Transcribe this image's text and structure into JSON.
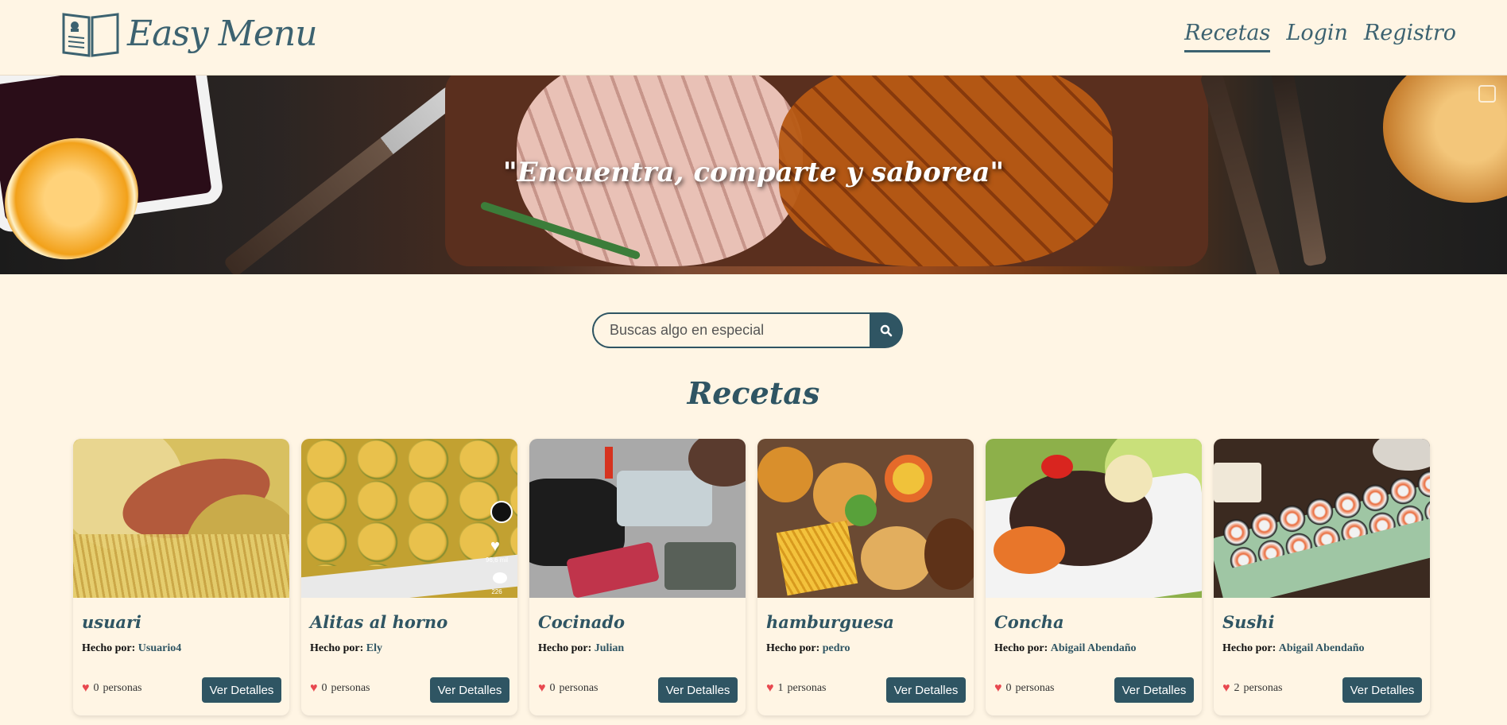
{
  "header": {
    "brand": "Easy Menu",
    "nav": [
      {
        "label": "Recetas",
        "active": true
      },
      {
        "label": "Login",
        "active": false
      },
      {
        "label": "Registro",
        "active": false
      }
    ]
  },
  "hero": {
    "quote": "\"Encuentra, comparte y saborea\""
  },
  "search": {
    "placeholder": "Buscas algo en especial",
    "value": ""
  },
  "section": {
    "title": "Recetas"
  },
  "recipes": [
    {
      "title": "usuari",
      "author_label": "Hecho por:",
      "author": "Usuario4",
      "likes": "0",
      "likes_unit": "personas",
      "button": "Ver Detalles"
    },
    {
      "title": "Alitas al horno",
      "author_label": "Hecho por:",
      "author": "Ely",
      "likes": "0",
      "likes_unit": "personas",
      "button": "Ver Detalles"
    },
    {
      "title": "Cocinado",
      "author_label": "Hecho por:",
      "author": "Julian",
      "likes": "0",
      "likes_unit": "personas",
      "button": "Ver Detalles"
    },
    {
      "title": "hamburguesa",
      "author_label": "Hecho por:",
      "author": "pedro",
      "likes": "1",
      "likes_unit": "personas",
      "button": "Ver Detalles"
    },
    {
      "title": "Concha",
      "author_label": "Hecho por:",
      "author": "Abigail Abendaño",
      "likes": "0",
      "likes_unit": "personas",
      "button": "Ver Detalles"
    },
    {
      "title": "Sushi",
      "author_label": "Hecho por:",
      "author": "Abigail Abendaño",
      "likes": "2",
      "likes_unit": "personas",
      "button": "Ver Detalles"
    }
  ],
  "recipe_overlay": {
    "likes_count": "96,6 mil",
    "comments_count": "226"
  },
  "colors": {
    "accent": "#2f5563",
    "background": "#fff5e4",
    "heart": "#e8484f"
  }
}
